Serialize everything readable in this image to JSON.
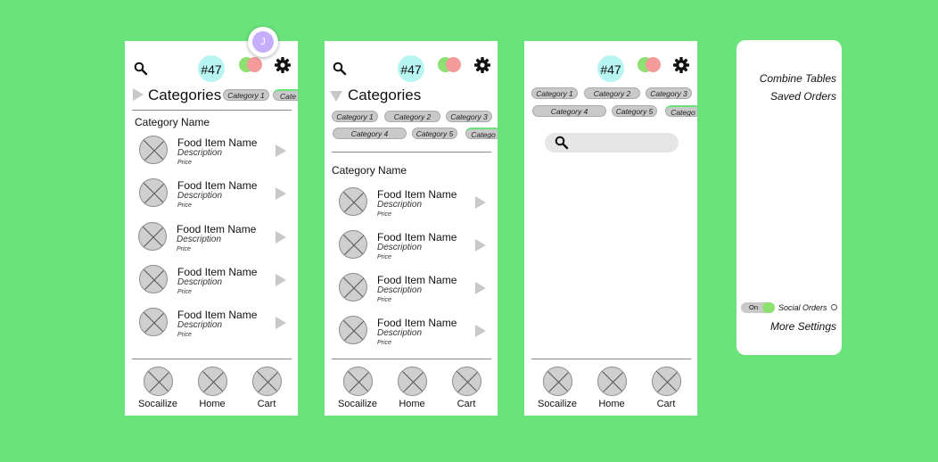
{
  "header": {
    "order_number": "#47",
    "avatar_initial": "J"
  },
  "categories": {
    "title": "Categories",
    "pills": [
      "Category 1",
      "Category 2",
      "Category 3",
      "Category 4",
      "Category 5",
      "Catego"
    ],
    "screen1_pills": [
      "Category 1",
      "Cate"
    ]
  },
  "menu": {
    "section_name": "Category Name",
    "items": [
      {
        "name": "Food Item Name",
        "description": "Description",
        "price": "Price"
      },
      {
        "name": "Food Item Name",
        "description": "Description",
        "price": "Price"
      },
      {
        "name": "Food Item Name",
        "description": "Description",
        "price": "Price"
      },
      {
        "name": "Food Item Name",
        "description": "Description",
        "price": "Price"
      },
      {
        "name": "Food Item Name",
        "description": "Description",
        "price": "Price"
      }
    ]
  },
  "bottom_nav": [
    "Socailize",
    "Home",
    "Cart"
  ],
  "settings_panel": {
    "combine_tables": "Combine Tables",
    "saved_orders": "Saved Orders",
    "toggle_state": "On",
    "social_orders": "Social Orders",
    "more_settings": "More Settings"
  },
  "colors": {
    "background": "#6be37b",
    "badge": "#b7f5f2",
    "green_dot": "#8ee070",
    "red_dot": "#f59a9a",
    "avatar": "#c6aefc"
  }
}
